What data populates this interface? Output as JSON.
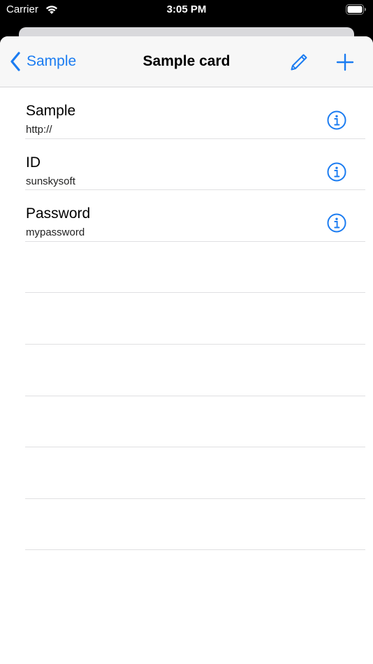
{
  "status_bar": {
    "carrier": "Carrier",
    "time": "3:05 PM"
  },
  "nav": {
    "back_label": "Sample",
    "title": "Sample card",
    "edit_icon": "pencil-icon",
    "add_icon": "plus-icon"
  },
  "rows": [
    {
      "title": "Sample",
      "subtitle": "http://"
    },
    {
      "title": "ID",
      "subtitle": "sunskysoft"
    },
    {
      "title": "Password",
      "subtitle": "mypassword"
    }
  ],
  "colors": {
    "accent": "#1b7cf1",
    "nav_background": "#f7f7f7",
    "separator": "#e0e0e2"
  }
}
